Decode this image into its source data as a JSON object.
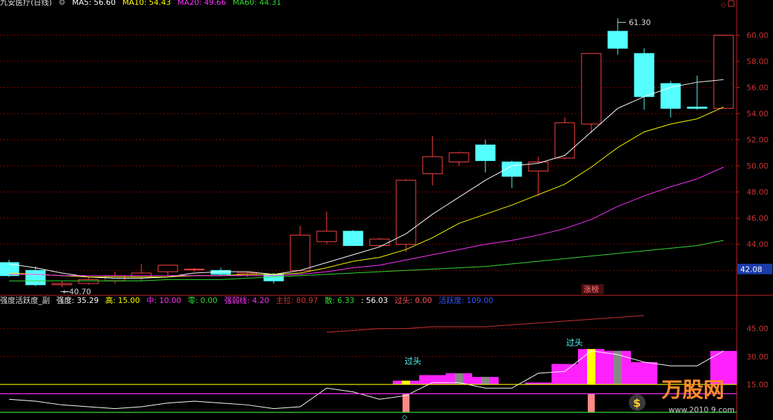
{
  "main_header": {
    "stock_name": "九安医疗(日线)",
    "indicators": [
      {
        "label": "MA5: 56.60",
        "color": "#ffffff"
      },
      {
        "label": "MA10: 54.43",
        "color": "#ffff00"
      },
      {
        "label": "MA20: 49.66",
        "color": "#ff33ff"
      },
      {
        "label": "MA60: 44.31",
        "color": "#33dd33"
      }
    ]
  },
  "sub_header": {
    "title": "强度活跃度_副",
    "items": [
      {
        "label": "强度: 35.29",
        "color": "#ffffff"
      },
      {
        "label": "高: 15.00",
        "color": "#ffff00"
      },
      {
        "label": "中: 10.00",
        "color": "#ff33ff"
      },
      {
        "label": "零: 0.00",
        "color": "#33dd33"
      },
      {
        "label": "强弱线: 4.20",
        "color": "#ff33ff"
      },
      {
        "label": "主拉: 80.97",
        "color": "#cc3333"
      },
      {
        "label": "散: 6.33",
        "color": "#33dd33"
      },
      {
        "label": ": 56.03",
        "color": "#ffffff"
      },
      {
        "label": "过头: 0.00",
        "color": "#ff5555"
      },
      {
        "label": "活跃度: 109.00",
        "color": "#3355ff"
      }
    ]
  },
  "annotations": {
    "high_label": "61.30",
    "low_label": "40.70",
    "limit_up": "涨榜",
    "guotou_1": "过头",
    "guotou_2": "过头",
    "current_price": "42.08",
    "watermark": "万股网",
    "watermark_url": "www.2010 9.com"
  },
  "colors": {
    "up": "#ff4444",
    "down": "#55ffff",
    "grid": "#8b0000",
    "axis": "#cc2222"
  },
  "chart_data": [
    {
      "type": "candlestick",
      "title": "九安医疗(日线)",
      "y_ticks": [
        "42.00",
        "44.00",
        "46.00",
        "48.00",
        "50.00",
        "52.00",
        "54.00",
        "56.00",
        "58.00",
        "60.00"
      ],
      "ylim": [
        40.2,
        62.0
      ],
      "candles": [
        {
          "o": 42.6,
          "h": 42.8,
          "c": 41.6,
          "l": 41.5
        },
        {
          "o": 42.0,
          "h": 42.3,
          "c": 40.9,
          "l": 40.8
        },
        {
          "o": 40.9,
          "h": 41.2,
          "c": 41.0,
          "l": 40.7
        },
        {
          "o": 41.0,
          "h": 41.5,
          "c": 41.3,
          "l": 40.9
        },
        {
          "o": 41.2,
          "h": 41.9,
          "c": 41.6,
          "l": 41.0
        },
        {
          "o": 41.5,
          "h": 42.5,
          "c": 41.8,
          "l": 41.2
        },
        {
          "o": 41.9,
          "h": 42.4,
          "c": 42.4,
          "l": 41.6
        },
        {
          "o": 42.1,
          "h": 42.2,
          "c": 42.1,
          "l": 41.9
        },
        {
          "o": 42.0,
          "h": 42.2,
          "c": 41.7,
          "l": 41.6
        },
        {
          "o": 41.7,
          "h": 41.9,
          "c": 41.8,
          "l": 41.5
        },
        {
          "o": 41.7,
          "h": 41.8,
          "c": 41.2,
          "l": 41.0
        },
        {
          "o": 42.0,
          "h": 45.4,
          "c": 44.7,
          "l": 41.9
        },
        {
          "o": 44.2,
          "h": 46.5,
          "c": 45.0,
          "l": 44.0
        },
        {
          "o": 45.0,
          "h": 45.1,
          "c": 43.9,
          "l": 43.9
        },
        {
          "o": 43.9,
          "h": 44.5,
          "c": 44.4,
          "l": 43.8
        },
        {
          "o": 44.0,
          "h": 49.0,
          "c": 48.9,
          "l": 43.4
        },
        {
          "o": 49.4,
          "h": 52.3,
          "c": 50.7,
          "l": 48.5
        },
        {
          "o": 50.3,
          "h": 51.1,
          "c": 51.0,
          "l": 50.0
        },
        {
          "o": 51.6,
          "h": 52.0,
          "c": 50.4,
          "l": 49.5
        },
        {
          "o": 50.3,
          "h": 50.4,
          "c": 49.2,
          "l": 48.3
        },
        {
          "o": 49.6,
          "h": 50.7,
          "c": 50.3,
          "l": 47.7
        },
        {
          "o": 50.6,
          "h": 53.7,
          "c": 53.3,
          "l": 50.5
        },
        {
          "o": 53.2,
          "h": 58.6,
          "c": 58.6,
          "l": 52.5
        },
        {
          "o": 60.3,
          "h": 61.3,
          "c": 59.0,
          "l": 58.5
        },
        {
          "o": 58.6,
          "h": 59.0,
          "c": 55.3,
          "l": 54.3
        },
        {
          "o": 56.3,
          "h": 56.5,
          "c": 54.4,
          "l": 53.7
        },
        {
          "o": 54.5,
          "h": 56.9,
          "c": 54.4,
          "l": 54.3
        },
        {
          "o": 54.4,
          "h": 60.0,
          "c": 60.0,
          "l": 54.4
        }
      ],
      "series": [
        {
          "name": "MA5",
          "color": "#ffffff",
          "values": [
            42.5,
            42.2,
            41.8,
            41.5,
            41.4,
            41.4,
            41.5,
            41.8,
            41.9,
            41.9,
            41.7,
            42.0,
            42.6,
            43.2,
            43.8,
            44.8,
            46.3,
            47.6,
            48.9,
            50.0,
            50.2,
            50.8,
            52.6,
            54.4,
            55.3,
            56.0,
            56.4,
            56.6
          ]
        },
        {
          "name": "MA10",
          "color": "#ffff00",
          "values": [
            41.8,
            41.7,
            41.6,
            41.5,
            41.5,
            41.5,
            41.5,
            41.6,
            41.6,
            41.7,
            41.7,
            41.8,
            42.2,
            42.7,
            43.0,
            43.6,
            44.5,
            45.6,
            46.3,
            47.0,
            47.8,
            48.6,
            49.9,
            51.4,
            52.6,
            53.2,
            53.6,
            54.5
          ]
        },
        {
          "name": "MA20",
          "color": "#ff33ff",
          "values": [
            41.7,
            41.7,
            41.6,
            41.6,
            41.6,
            41.6,
            41.6,
            41.6,
            41.6,
            41.6,
            41.6,
            41.7,
            41.9,
            42.2,
            42.4,
            42.8,
            43.2,
            43.6,
            44.0,
            44.3,
            44.7,
            45.2,
            45.9,
            46.9,
            47.7,
            48.4,
            49.0,
            49.9
          ]
        },
        {
          "name": "MA60",
          "color": "#33dd33",
          "values": [
            41.2,
            41.2,
            41.2,
            41.2,
            41.2,
            41.2,
            41.3,
            41.3,
            41.3,
            41.4,
            41.5,
            41.6,
            41.7,
            41.8,
            41.9,
            42.0,
            42.1,
            42.2,
            42.3,
            42.5,
            42.7,
            42.9,
            43.1,
            43.3,
            43.5,
            43.7,
            43.9,
            44.3
          ]
        }
      ]
    },
    {
      "type": "bar",
      "title": "强度活跃度_副",
      "y_ticks": [
        "15.00",
        "30.00",
        "45.00"
      ],
      "ylim": [
        0,
        58
      ],
      "strength_bars": [
        0,
        0,
        0,
        0,
        0,
        0,
        0,
        0,
        0,
        0,
        0,
        0,
        0,
        0,
        0,
        17,
        20,
        21,
        19,
        0,
        16,
        26,
        34,
        33,
        27,
        0,
        0,
        33
      ],
      "highlight_bars": [
        {
          "i": 15,
          "color": "#ffff00"
        },
        {
          "i": 17,
          "color": "#888888"
        },
        {
          "i": 18,
          "color": "#888888"
        },
        {
          "i": 22,
          "color": "#ffff00"
        },
        {
          "i": 23,
          "color": "#888888"
        }
      ],
      "lines": [
        {
          "name": "强度",
          "color": "#ffffff",
          "values": [
            7,
            6,
            4,
            3,
            2,
            3,
            5,
            6,
            5,
            4,
            2,
            3,
            13,
            11,
            7,
            9,
            16,
            16,
            13,
            13,
            21,
            22,
            33,
            31,
            27,
            25,
            25,
            33
          ]
        },
        {
          "name": "主拉",
          "color": "#cc3333",
          "values": [
            null,
            null,
            null,
            null,
            null,
            null,
            null,
            null,
            null,
            null,
            null,
            null,
            43,
            44,
            45,
            45,
            46,
            46,
            46,
            47,
            48,
            49,
            50,
            51,
            52,
            null,
            null,
            null
          ]
        },
        {
          "name": "高",
          "color": "#ffff00",
          "values": [
            15,
            15,
            15,
            15,
            15,
            15,
            15,
            15,
            15,
            15,
            15,
            15,
            15,
            15,
            15,
            15,
            15,
            15,
            15,
            15,
            15,
            15,
            15,
            15,
            15,
            15,
            15,
            15
          ]
        },
        {
          "name": "中",
          "color": "#ff33ff",
          "values": [
            10,
            10,
            10,
            10,
            10,
            10,
            10,
            10,
            10,
            10,
            10,
            10,
            10,
            10,
            10,
            10,
            10,
            10,
            10,
            10,
            10,
            10,
            10,
            10,
            10,
            10,
            10,
            10
          ]
        },
        {
          "name": "零",
          "color": "#33dd33",
          "values": [
            0,
            0,
            0,
            0,
            0,
            0,
            0,
            0,
            0,
            0,
            0,
            0,
            0,
            0,
            0,
            0,
            0,
            0,
            0,
            0,
            0,
            0,
            0,
            0,
            0,
            0,
            0,
            0
          ]
        }
      ],
      "signal_bars": [
        15,
        22
      ]
    }
  ]
}
